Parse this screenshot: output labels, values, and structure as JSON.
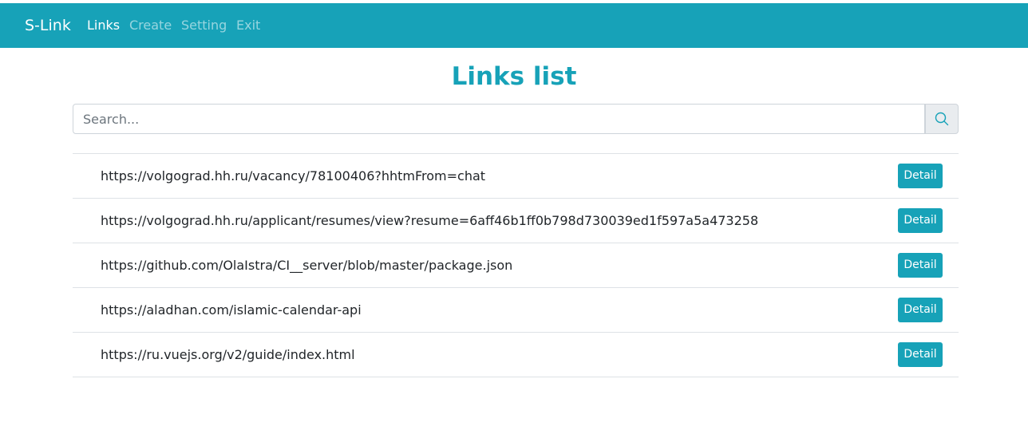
{
  "navbar": {
    "brand": "S-Link",
    "items": [
      {
        "label": "Links",
        "active": true
      },
      {
        "label": "Create",
        "active": false
      },
      {
        "label": "Setting",
        "active": false
      },
      {
        "label": "Exit",
        "active": false
      }
    ]
  },
  "page": {
    "title": "Links list"
  },
  "search": {
    "placeholder": "Search...",
    "value": "",
    "button_icon": "search-icon"
  },
  "links": [
    {
      "url": "https://volgograd.hh.ru/vacancy/78100406?hhtmFrom=chat",
      "action": "Detail"
    },
    {
      "url": "https://volgograd.hh.ru/applicant/resumes/view?resume=6aff46b1ff0b798d730039ed1f597a5a473258",
      "action": "Detail"
    },
    {
      "url": "https://github.com/OlaIstra/CI__server/blob/master/package.json",
      "action": "Detail"
    },
    {
      "url": "https://aladhan.com/islamic-calendar-api",
      "action": "Detail"
    },
    {
      "url": "https://ru.vuejs.org/v2/guide/index.html",
      "action": "Detail"
    }
  ],
  "colors": {
    "accent": "#17a2b8",
    "border": "#dee2e6"
  }
}
